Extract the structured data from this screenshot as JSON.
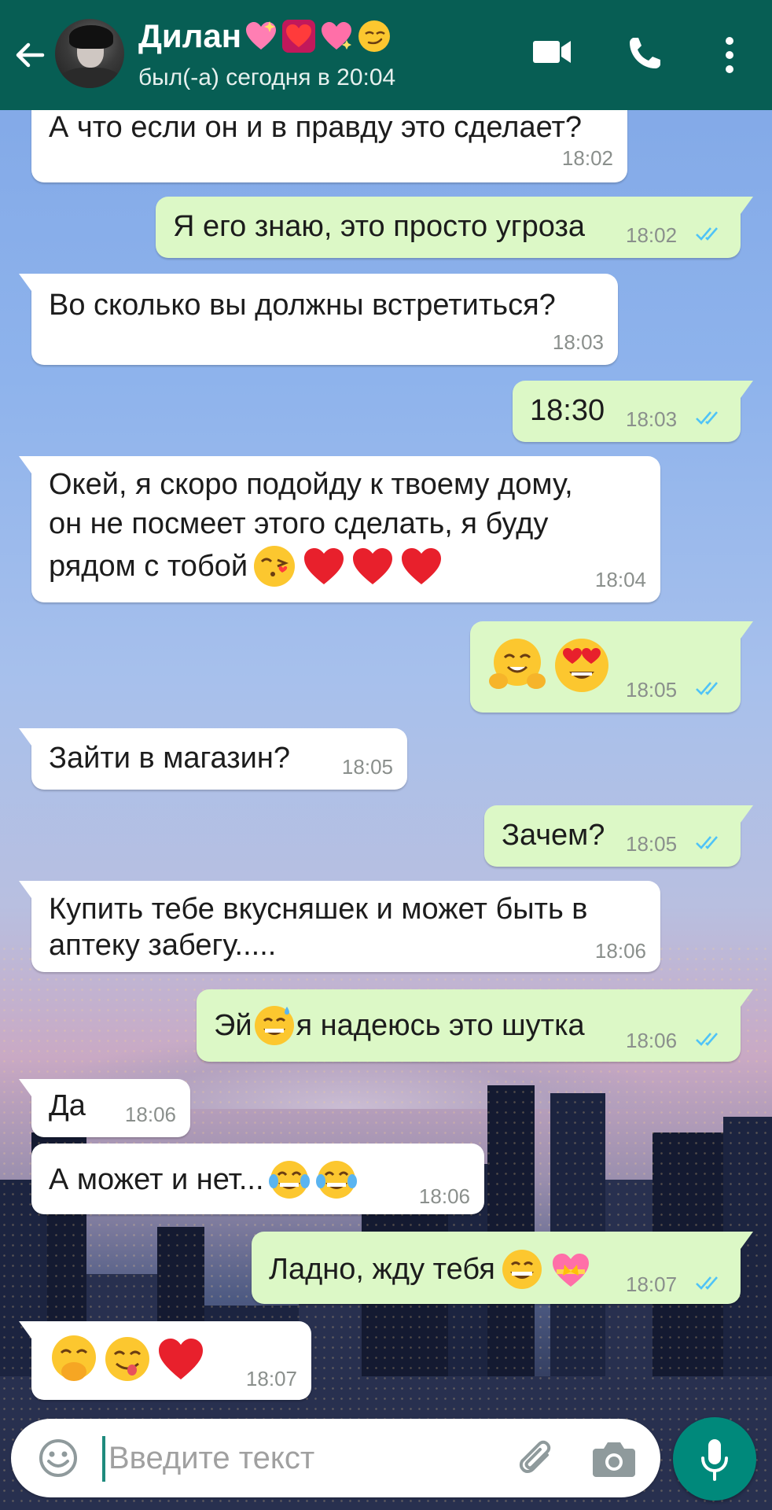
{
  "header": {
    "contact_name": "Дилан",
    "name_emoji": [
      "sparkling-heart-emoji",
      "heart-decoration-emoji",
      "heart-with-ribbon-sparkles-emoji",
      "smirking-face-emoji"
    ],
    "status": "был(-а) сегодня в 20:04",
    "icons": [
      "back-arrow-icon",
      "avatar",
      "video-call-icon",
      "voice-call-icon",
      "more-options-icon"
    ]
  },
  "messages": [
    {
      "direction": "in",
      "text": "А что если он и в правду это сделает?",
      "time": "18:02"
    },
    {
      "direction": "out",
      "text": "Я его знаю, это просто угроза",
      "time": "18:02",
      "status": "read"
    },
    {
      "direction": "in",
      "text": "Во сколько вы должны встретиться?",
      "time": "18:03"
    },
    {
      "direction": "out",
      "text": "18:30",
      "time": "18:03",
      "status": "read"
    },
    {
      "direction": "in",
      "lines": [
        "Окей, я скоро подойду к твоему дому,",
        "он не посмеет этого сделать, я буду",
        "рядом с тобой"
      ],
      "emoji": [
        "face-blowing-kiss-emoji",
        "red-heart-emoji",
        "red-heart-emoji",
        "red-heart-emoji"
      ],
      "time": "18:04"
    },
    {
      "direction": "out",
      "text": "",
      "emoji": [
        "hugging-face-emoji",
        "heart-eyes-emoji"
      ],
      "time": "18:05",
      "status": "read"
    },
    {
      "direction": "in",
      "text": "Зайти в магазин?",
      "time": "18:05"
    },
    {
      "direction": "out",
      "text": "Зачем?",
      "time": "18:05",
      "status": "read"
    },
    {
      "direction": "in",
      "lines": [
        "Купить тебе вкусняшек и может быть в",
        "аптеку забегу....."
      ],
      "time": "18:06"
    },
    {
      "direction": "out",
      "text_before": "Эй",
      "text_after": "я надеюсь это шутка",
      "emoji": [
        "grinning-sweat-emoji"
      ],
      "time": "18:06",
      "status": "read"
    },
    {
      "direction": "in",
      "text": "Да",
      "time": "18:06"
    },
    {
      "direction": "in",
      "text": "А может и нет...",
      "emoji": [
        "tears-of-joy-emoji",
        "tears-of-joy-emoji"
      ],
      "time": "18:06"
    },
    {
      "direction": "out",
      "text": "Ладно, жду тебя",
      "emoji": [
        "grinning-face-emoji",
        "heart-with-ribbon-emoji"
      ],
      "time": "18:07",
      "status": "read"
    },
    {
      "direction": "in",
      "text": "",
      "emoji": [
        "hand-over-mouth-emoji",
        "savoring-food-emoji",
        "red-heart-emoji"
      ],
      "time": "18:07"
    }
  ],
  "input_bar": {
    "placeholder": "Введите текст",
    "icons": [
      "emoji-smiley-icon",
      "attach-clip-icon",
      "camera-icon",
      "microphone-icon"
    ]
  },
  "colors": {
    "header_bg": "#075e54",
    "outgoing_bubble": "#dcf8c6",
    "incoming_bubble": "#ffffff",
    "read_ticks": "#4fc3f7",
    "mic_button": "#00897b"
  }
}
